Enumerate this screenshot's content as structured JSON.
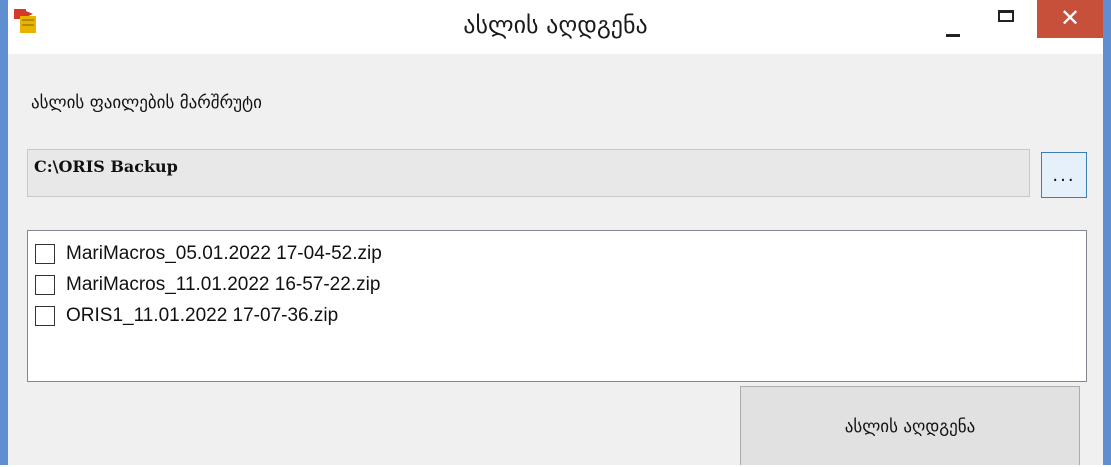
{
  "window": {
    "title": "ასლის აღდგენა",
    "close_glyph": "✕"
  },
  "path": {
    "label": "ასლის ფაილების მარშრუტი",
    "value": "C:\\ORIS Backup",
    "browse_label": "..."
  },
  "files": [
    {
      "name": "MariMacros_05.01.2022 17-04-52.zip",
      "checked": false
    },
    {
      "name": "MariMacros_11.01.2022 16-57-22.zip",
      "checked": false
    },
    {
      "name": "ORIS1_11.01.2022 17-07-36.zip",
      "checked": false
    }
  ],
  "actions": {
    "restore_label": "ასლის აღდგენა"
  },
  "colors": {
    "window_border": "#5f8fd0",
    "close_button": "#c7503a",
    "accent_border": "#3c7fb1"
  }
}
